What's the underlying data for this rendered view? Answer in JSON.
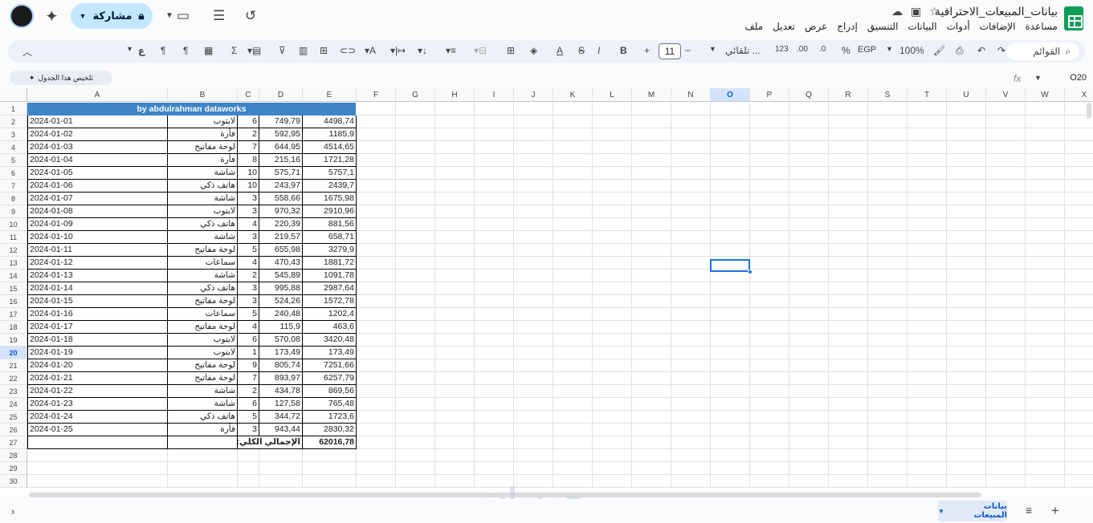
{
  "title": "بيانات_المبيعات_الاحترافية",
  "menu": [
    "ملف",
    "تعديل",
    "عرض",
    "إدراج",
    "التنسيق",
    "البيانات",
    "أدوات",
    "الإضافات",
    "مساعدة"
  ],
  "share_label": "مشاركة",
  "toolbar": {
    "search_menus": "القوائم",
    "zoom": "100%",
    "currency": "EGP",
    "percent": "%",
    "decimal_dec": ".0",
    "decimal_inc": ".00",
    "format_123": "123",
    "font": "تلقائي ...",
    "font_size": "11",
    "bold": "B",
    "sum": "Σ"
  },
  "summarize_label": "تلخيص هذا الجدول",
  "name_box": "O20",
  "columns": [
    "A",
    "B",
    "C",
    "D",
    "E",
    "F",
    "G",
    "H",
    "I",
    "J",
    "K",
    "L",
    "M",
    "N",
    "O",
    "P",
    "Q",
    "R",
    "S",
    "T",
    "U",
    "V",
    "W",
    "X"
  ],
  "rows_count": 30,
  "selected_row": 20,
  "selected_col": "O",
  "banner": "by abdulrahman dataworks",
  "data_rows": [
    [
      "2024-01-01",
      "لابتوب",
      "6",
      "749,79",
      "4498,74"
    ],
    [
      "2024-01-02",
      "فأرة",
      "2",
      "592,95",
      "1185,9"
    ],
    [
      "2024-01-03",
      "لوحة مفاتيح",
      "7",
      "644,95",
      "4514,65"
    ],
    [
      "2024-01-04",
      "فأرة",
      "8",
      "215,16",
      "1721,28"
    ],
    [
      "2024-01-05",
      "شاشة",
      "10",
      "575,71",
      "5757,1"
    ],
    [
      "2024-01-06",
      "هاتف ذكي",
      "10",
      "243,97",
      "2439,7"
    ],
    [
      "2024-01-07",
      "شاشة",
      "3",
      "558,66",
      "1675,98"
    ],
    [
      "2024-01-08",
      "لابتوب",
      "3",
      "970,32",
      "2910,96"
    ],
    [
      "2024-01-09",
      "هاتف ذكي",
      "4",
      "220,39",
      "881,56"
    ],
    [
      "2024-01-10",
      "شاشة",
      "3",
      "219,57",
      "658,71"
    ],
    [
      "2024-01-11",
      "لوحة مفاتيح",
      "5",
      "655,98",
      "3279,9"
    ],
    [
      "2024-01-12",
      "سماعات",
      "4",
      "470,43",
      "1881,72"
    ],
    [
      "2024-01-13",
      "شاشة",
      "2",
      "545,89",
      "1091,78"
    ],
    [
      "2024-01-14",
      "هاتف ذكي",
      "3",
      "995,88",
      "2987,64"
    ],
    [
      "2024-01-15",
      "لوحة مفاتيح",
      "3",
      "524,26",
      "1572,78"
    ],
    [
      "2024-01-16",
      "سماعات",
      "5",
      "240,48",
      "1202,4"
    ],
    [
      "2024-01-17",
      "لوحة مفاتيح",
      "4",
      "115,9",
      "463,6"
    ],
    [
      "2024-01-18",
      "لابتوب",
      "6",
      "570,08",
      "3420,48"
    ],
    [
      "2024-01-19",
      "لابتوب",
      "1",
      "173,49",
      "173,49"
    ],
    [
      "2024-01-20",
      "لوحة مفاتيح",
      "9",
      "805,74",
      "7251,66"
    ],
    [
      "2024-01-21",
      "لوحة مفاتيح",
      "7",
      "893,97",
      "6257,79"
    ],
    [
      "2024-01-22",
      "شاشة",
      "2",
      "434,78",
      "869,56"
    ],
    [
      "2024-01-23",
      "شاشة",
      "6",
      "127,58",
      "765,48"
    ],
    [
      "2024-01-24",
      "هاتف ذكي",
      "5",
      "344,72",
      "1723,6"
    ],
    [
      "2024-01-25",
      "فأرة",
      "3",
      "943,44",
      "2830,32"
    ]
  ],
  "total_label": "الإجمالي الكلي:",
  "total_value": "62016,78",
  "sheet_tab": "بيانات المبيعات",
  "watermark": "خمسات"
}
